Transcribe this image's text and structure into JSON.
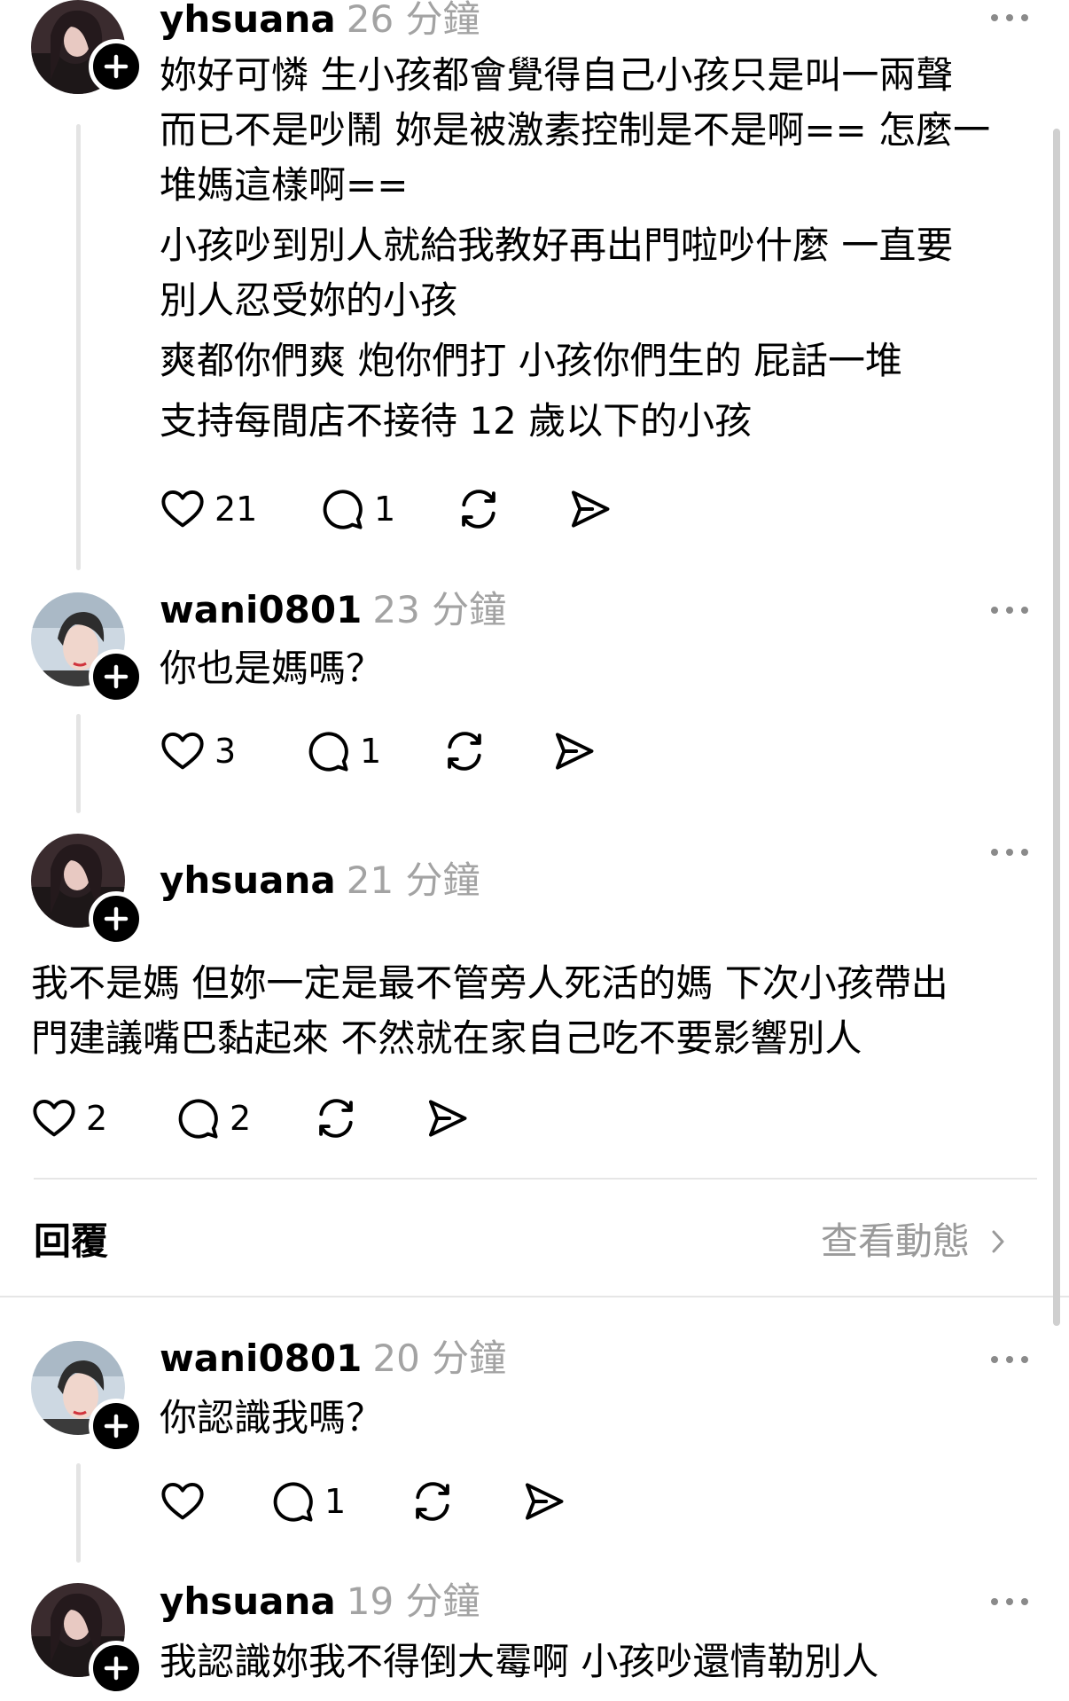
{
  "posts": [
    {
      "username": "yhsuana",
      "time": "26 分鐘",
      "lines": [
        "妳好可憐 生小孩都會覺得自己小孩只是叫一兩聲",
        "而已不是吵鬧 妳是被激素控制是不是啊== 怎麼一",
        "堆媽這樣啊==",
        "小孩吵到別人就給我教好再出門啦吵什麼 一直要",
        "別人忍受妳的小孩",
        "爽都你們爽 炮你們打 小孩你們生的 屁話一堆",
        "支持每間店不接待 12 歲以下的小孩"
      ],
      "likes": "21",
      "replies": "1"
    },
    {
      "username": "wani0801",
      "time": "23 分鐘",
      "lines": [
        "你也是媽嗎？"
      ],
      "likes": "3",
      "replies": "1"
    },
    {
      "username": "yhsuana",
      "time": "21 分鐘",
      "lines": [
        "我不是媽 但妳一定是最不管旁人死活的媽 下次小孩帶出",
        "門建議嘴巴黏起來 不然就在家自己吃不要影響別人"
      ],
      "likes": "2",
      "replies": "2"
    },
    {
      "username": "wani0801",
      "time": "20 分鐘",
      "lines": [
        "你認識我嗎？"
      ],
      "likes": "",
      "replies": "1"
    },
    {
      "username": "yhsuana",
      "time": "19 分鐘",
      "lines": [
        "我認識妳我不得倒大霉啊 小孩吵還情勒別人"
      ]
    }
  ],
  "section": {
    "reply_label": "回覆",
    "activity_link": "查看動態"
  },
  "icons": {
    "like": "heart-icon",
    "reply": "comment-icon",
    "repost": "repost-icon",
    "share": "send-icon",
    "more": "more-dots-icon",
    "follow": "plus-icon",
    "chevron": "chevron-right-icon"
  }
}
